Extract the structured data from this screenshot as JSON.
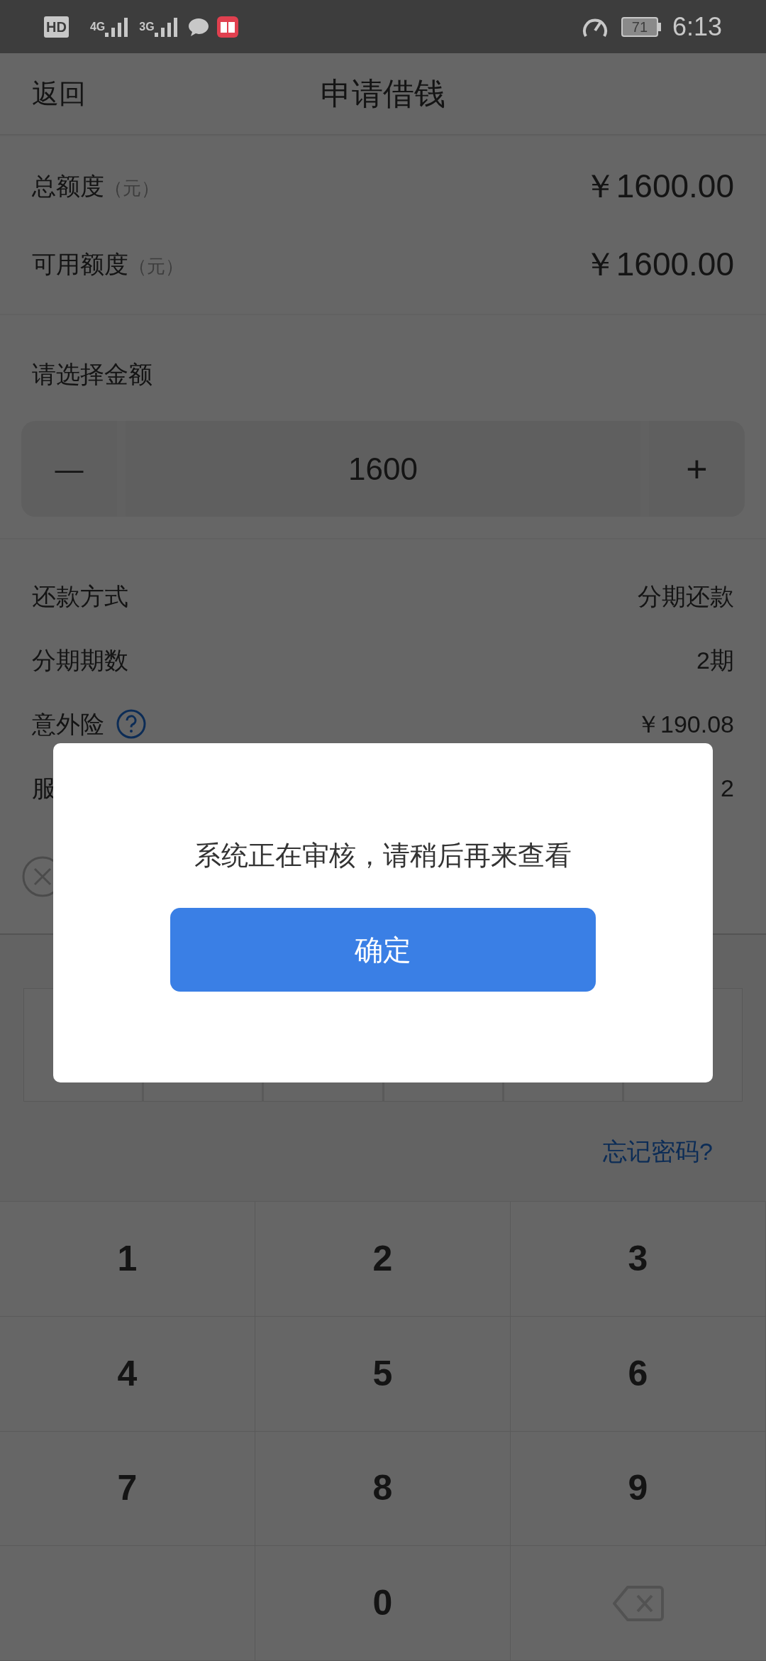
{
  "status_bar": {
    "hd": "HD",
    "network_1": "4G",
    "network_2": "3G",
    "battery": "71",
    "time": "6:13"
  },
  "header": {
    "back": "返回",
    "title": "申请借钱"
  },
  "limits": [
    {
      "label": "总额度",
      "unit": "（元）",
      "value": "￥1600.00"
    },
    {
      "label": "可用额度",
      "unit": "（元）",
      "value": "￥1600.00"
    }
  ],
  "amount": {
    "label": "请选择金额",
    "minus": "—",
    "value": "1600",
    "plus": "+"
  },
  "details": [
    {
      "label": "还款方式",
      "value": "分期还款",
      "help": false
    },
    {
      "label": "分期期数",
      "value": "2期",
      "help": false
    },
    {
      "label": "意外险",
      "value": "￥190.08",
      "help": true
    },
    {
      "label": "服",
      "value": "2"
    }
  ],
  "password": {
    "forgot": "忘记密码?"
  },
  "keypad": [
    "1",
    "2",
    "3",
    "4",
    "5",
    "6",
    "7",
    "8",
    "9",
    "0"
  ],
  "dialog": {
    "message": "系统正在审核，请稍后再来查看",
    "button": "确定"
  }
}
